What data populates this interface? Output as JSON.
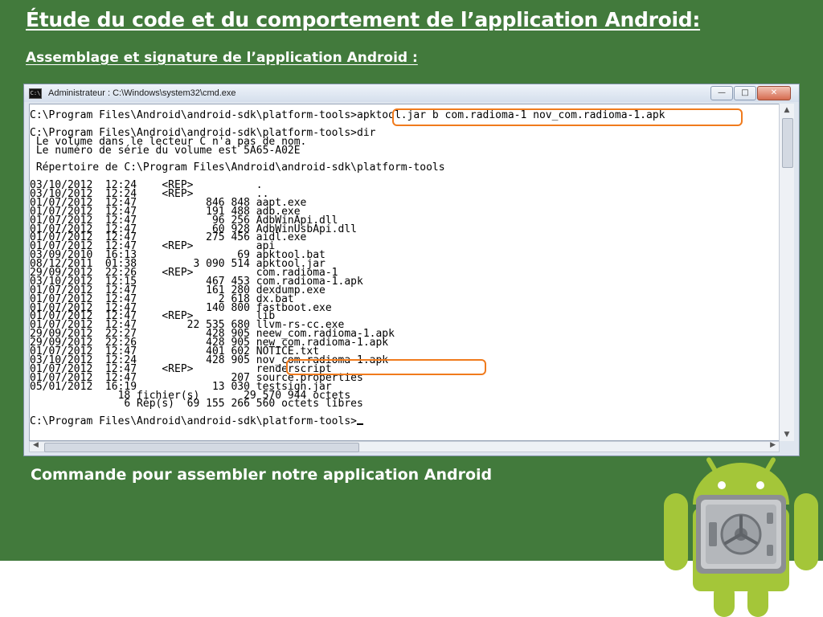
{
  "slide": {
    "title": "Étude du code et du comportement de l’application Android:",
    "subtitle": "Assemblage et signature de l’application Android  :",
    "caption": "Commande pour assembler notre application Android"
  },
  "cmd_window": {
    "title": "Administrateur : C:\\Windows\\system32\\cmd.exe",
    "icon": "cmd-icon",
    "controls": {
      "minimize": "—",
      "maximize": "□",
      "close": "✕"
    },
    "lines": [
      "C:\\Program Files\\Android\\android-sdk\\platform-tools>apktool.jar b com.radioma-1 nov_com.radioma-1.apk",
      "",
      "C:\\Program Files\\Android\\android-sdk\\platform-tools>dir",
      " Le volume dans le lecteur C n'a pas de nom.",
      " Le numéro de série du volume est 5A65-A02E",
      "",
      " Répertoire de C:\\Program Files\\Android\\android-sdk\\platform-tools",
      "",
      "03/10/2012  12:24    <REP>          .",
      "03/10/2012  12:24    <REP>          ..",
      "01/07/2012  12:47           846 848 aapt.exe",
      "01/07/2012  12:47           191 488 adb.exe",
      "01/07/2012  12:47            96 256 AdbWinApi.dll",
      "01/07/2012  12:47            60 928 AdbWinUsbApi.dll",
      "01/07/2012  12:47           275 456 aidl.exe",
      "01/07/2012  12:47    <REP>          api",
      "03/09/2010  16:13                69 apktool.bat",
      "08/12/2011  01:38         3 090 514 apktool.jar",
      "29/09/2012  22:26    <REP>          com.radioma-1",
      "03/10/2012  12:15           467 453 com.radioma-1.apk",
      "01/07/2012  12:47           161 280 dexdump.exe",
      "01/07/2012  12:47             2 618 dx.bat",
      "01/07/2012  12:47           140 800 fastboot.exe",
      "01/07/2012  12:47    <REP>          lib",
      "01/07/2012  12:47        22 535 680 llvm-rs-cc.exe",
      "29/09/2012  22:27           428 905 neew_com.radioma-1.apk",
      "29/09/2012  22:26           428 905 new_com.radioma-1.apk",
      "01/07/2012  12:47           401 602 NOTICE.txt",
      "03/10/2012  12:24           428 905 nov_com.radioma-1.apk",
      "01/07/2012  12:47    <REP>          renderscript",
      "01/07/2012  12:47               207 source.properties",
      "05/01/2012  16:19            13 030 testsign.jar",
      "              18 fichier(s)       29 570 944 octets",
      "               6 Rép(s)  69 155 266 560 octets libres",
      "",
      "C:\\Program Files\\Android\\android-sdk\\platform-tools>"
    ]
  },
  "colors": {
    "slide_green": "#427a3c",
    "highlight_orange": "#f07b1d",
    "android_green": "#a4c639"
  },
  "decorations": {
    "mascot": "android-robot-with-vault-icon"
  }
}
